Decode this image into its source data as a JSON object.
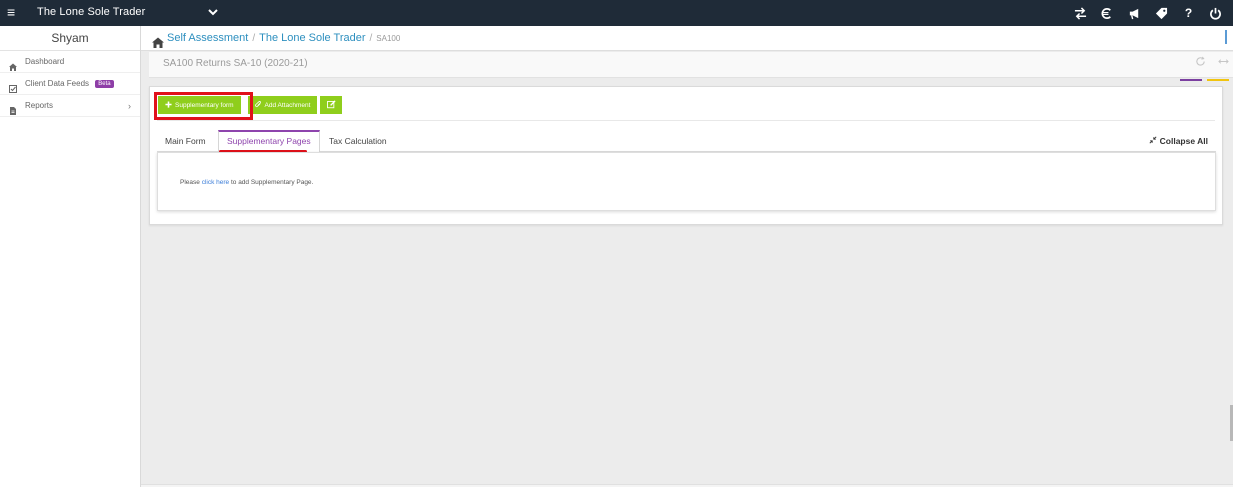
{
  "topbar": {
    "brand": "The Lone Sole Trader",
    "menu_icon": "≡",
    "icons": [
      "transfer-icon",
      "currency-icon",
      "megaphone-icon",
      "tag-icon",
      "help-icon",
      "power-icon"
    ],
    "help_label": "?"
  },
  "sidebar": {
    "user_name": "Shyam",
    "items": [
      {
        "label": "Dashboard",
        "icon": "home-icon"
      },
      {
        "label": "Client Data Feeds",
        "icon": "check-square-icon",
        "badge": "Beta"
      },
      {
        "label": "Reports",
        "icon": "file-icon",
        "chevron": "›"
      }
    ]
  },
  "breadcrumb": {
    "home_label": "Self Assessment",
    "client_label": "The Lone Sole Trader",
    "current": "SA100",
    "separator": "/"
  },
  "page": {
    "title": "SA100 Returns SA-10 (2020-21)"
  },
  "toolbar": {
    "supplementary_form": "Supplementary form",
    "add_attachment": "Add Attachment"
  },
  "tabs": {
    "items": [
      "Main Form",
      "Supplementary Pages",
      "Tax Calculation"
    ],
    "active_index": 1,
    "collapse_all": "Collapse All"
  },
  "panel": {
    "msg_prefix": "Please",
    "msg_link": "click here",
    "msg_suffix": "to add Supplementary Page."
  },
  "colors": {
    "topbar": "#1f2b38",
    "accent_green": "#8fce1c",
    "accent_purple": "#8e44ad",
    "highlight_red": "#e0111a",
    "link_blue": "#2d8fbf"
  }
}
